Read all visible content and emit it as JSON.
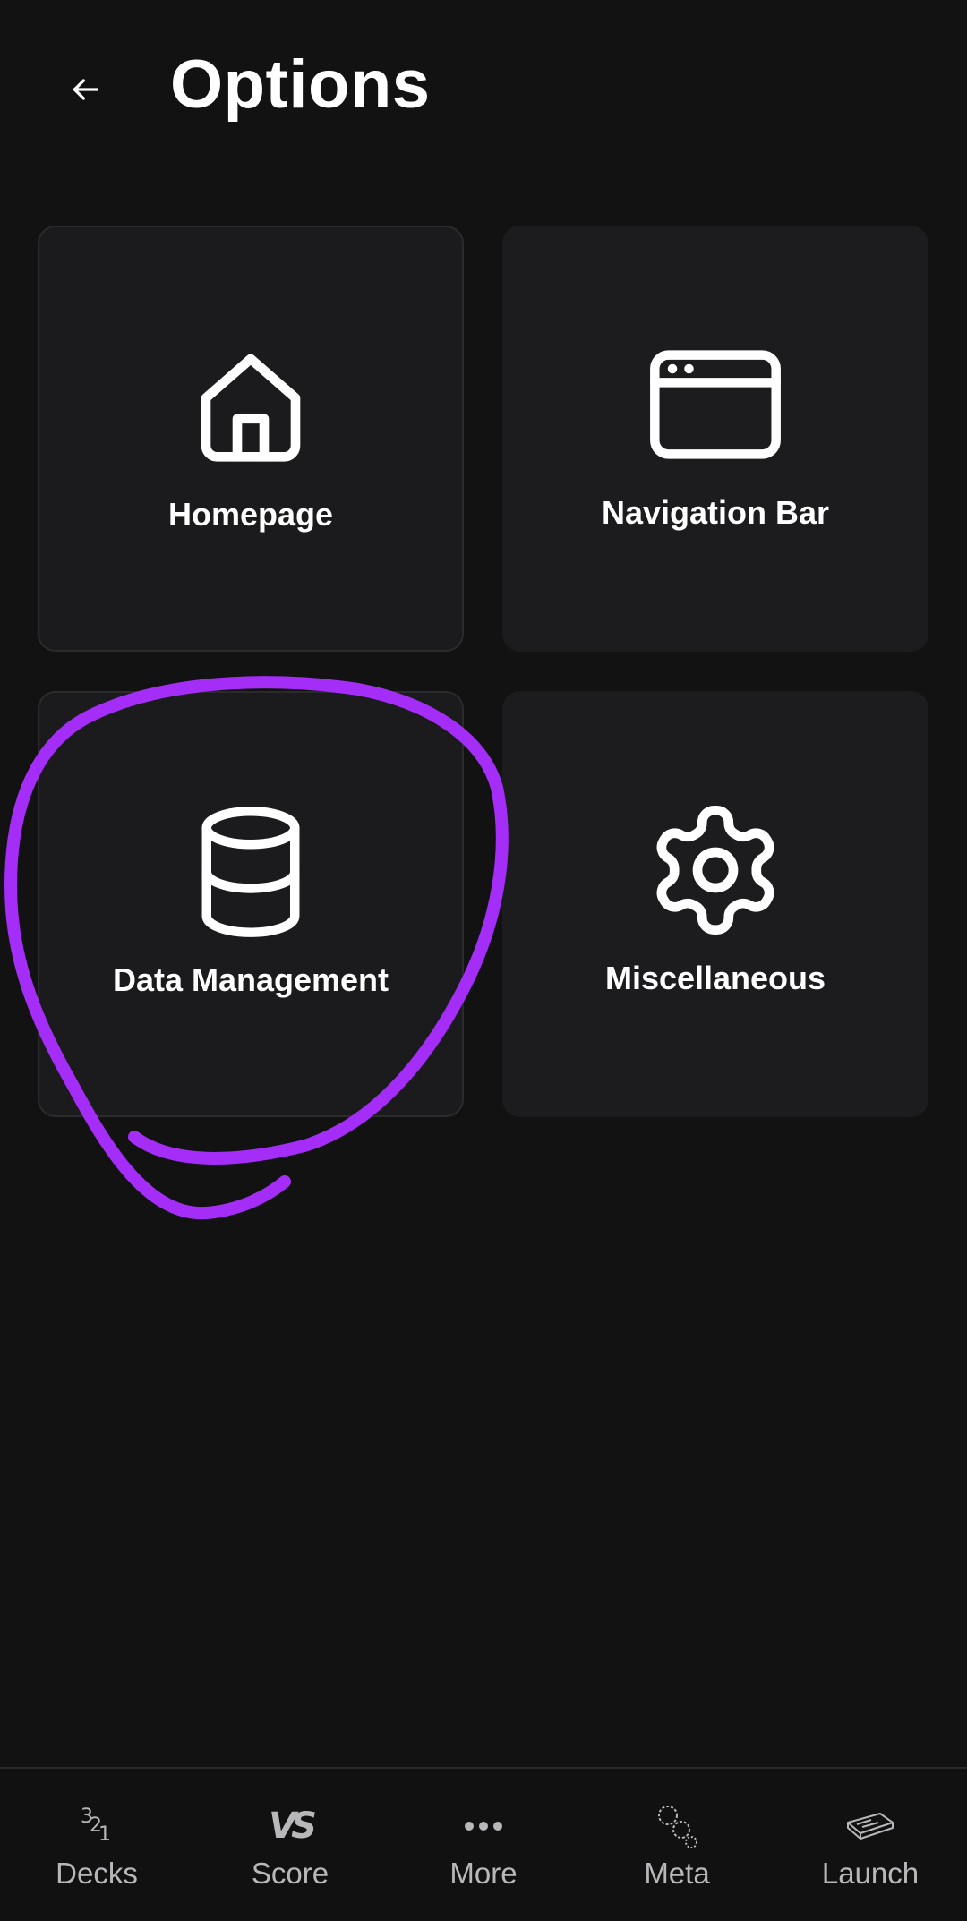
{
  "header": {
    "title": "Options"
  },
  "cards": [
    {
      "label": "Homepage",
      "icon": "home-icon"
    },
    {
      "label": "Navigation Bar",
      "icon": "browser-window-icon"
    },
    {
      "label": "Data Management",
      "icon": "database-icon"
    },
    {
      "label": "Miscellaneous",
      "icon": "gear-icon"
    }
  ],
  "bottom_nav": [
    {
      "label": "Decks",
      "icon": "numbers-321-icon"
    },
    {
      "label": "Score",
      "icon": "vs-icon"
    },
    {
      "label": "More",
      "icon": "ellipsis-icon"
    },
    {
      "label": "Meta",
      "icon": "meta-dice-icon"
    },
    {
      "label": "Launch",
      "icon": "launch-device-icon"
    }
  ],
  "colors": {
    "background": "#121213",
    "card": "#1c1c1e",
    "annotation": "#a42ef7",
    "nav_text": "#b8b8bb"
  }
}
